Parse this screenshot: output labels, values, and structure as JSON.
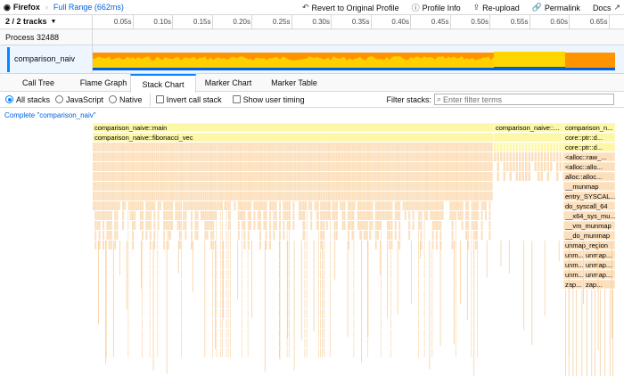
{
  "topbar": {
    "app_name": "Firefox",
    "range": "Full Range (662ms)",
    "actions": [
      {
        "icon": "revert-icon",
        "glyph": "↶",
        "label": "Revert to Original Profile"
      },
      {
        "icon": "info-icon",
        "glyph": "ⓘ",
        "label": "Profile Info"
      },
      {
        "icon": "upload-icon",
        "glyph": "⇪",
        "label": "Re-upload"
      },
      {
        "icon": "link-icon",
        "glyph": "🔗",
        "label": "Permalink"
      },
      {
        "icon": "external-link-icon",
        "glyph": "↗",
        "label": "Docs"
      }
    ]
  },
  "timeline": {
    "tracks_count": "2 / 2 tracks",
    "ticks": [
      "0.05s",
      "0.10s",
      "0.15s",
      "0.20s",
      "0.25s",
      "0.30s",
      "0.35s",
      "0.40s",
      "0.45s",
      "0.50s",
      "0.55s",
      "0.60s",
      "0.65s"
    ],
    "process_label": "Process 32488",
    "thread_label": "comparison_naiv"
  },
  "tabs": [
    "Call Tree",
    "Flame Graph",
    "Stack Chart",
    "Marker Chart",
    "Marker Table"
  ],
  "active_tab": "Stack Chart",
  "settings": {
    "radios": [
      "All stacks",
      "JavaScript",
      "Native"
    ],
    "selected_radio": "All stacks",
    "checks": [
      "Invert call stack",
      "Show user timing"
    ],
    "filter_label": "Filter stacks:",
    "filter_placeholder": "Enter filter terms",
    "filter_value": ""
  },
  "breadcrumb": "Complete \"comparison_naiv\"",
  "stack": {
    "colors": {
      "yellow": "#fdf7a8",
      "yellow_border": "#ede27a",
      "orange": "#fce0bd",
      "orange_dark": "#f8cf9d",
      "graph_orange": "#ff9400",
      "graph_yellow": "#ffd600",
      "graph_blue": "#0060df"
    },
    "row1": [
      "comparison_naive::main",
      "comparison_naive::...",
      "comparison_n..."
    ],
    "row2": [
      "comparison_naive::fibonacci_vec",
      "core::ptr::d...",
      "core::ptr::d..."
    ],
    "right_column": [
      "<alloc::raw_...",
      "<alloc::allo...",
      "alloc::alloc...",
      "__munmap",
      "entry_SYSCAL...",
      "do_syscall_64",
      "__x64_sys_mu...",
      "__vm_munmap",
      "__do_munmap",
      "unmap_region"
    ],
    "split_rows": [
      [
        "unm...",
        "unmap..."
      ],
      [
        "unm...",
        "unmap..."
      ],
      [
        "unm...",
        "unmap..."
      ],
      [
        "zap...",
        "zap..."
      ]
    ]
  }
}
